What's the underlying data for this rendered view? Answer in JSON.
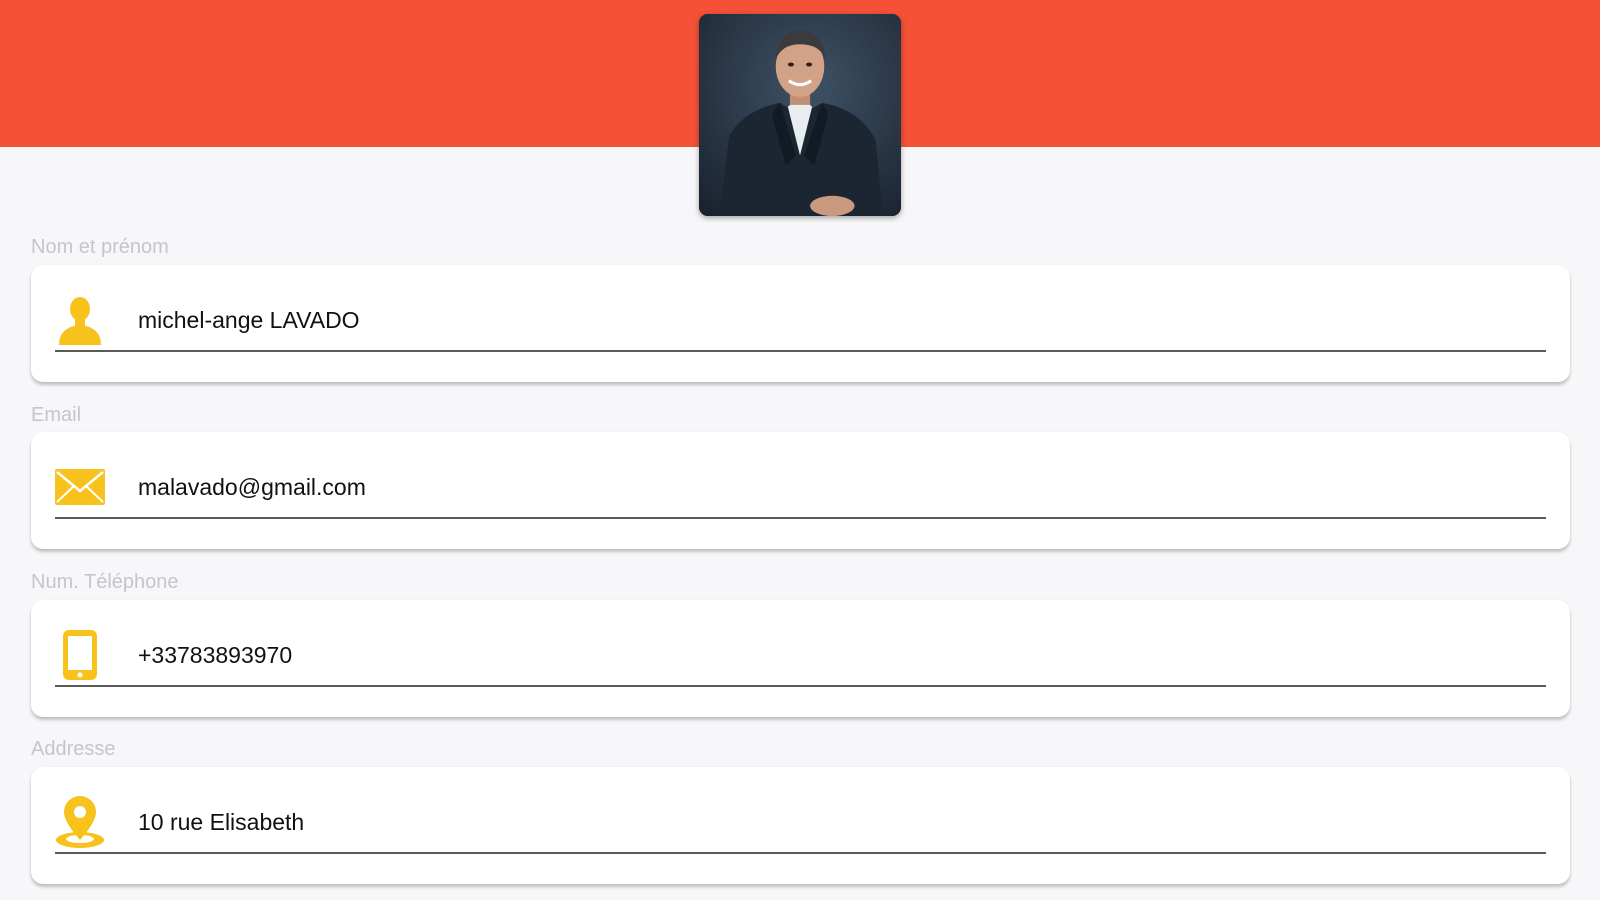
{
  "colors": {
    "header": "#f55137",
    "background": "#f7f7f9",
    "icon_accent": "#f7c21b",
    "label": "#c6c6c9",
    "value": "#111111"
  },
  "profile": {
    "avatar": "profile-photo"
  },
  "fields": {
    "name": {
      "label": "Nom et prénom",
      "value": "michel-ange LAVADO",
      "icon": "user-icon"
    },
    "email": {
      "label": "Email",
      "value": "malavado@gmail.com",
      "icon": "envelope-icon"
    },
    "phone": {
      "label": "Num. Téléphone",
      "value": "+33783893970",
      "icon": "smartphone-icon"
    },
    "address": {
      "label": "Addresse",
      "value": "10 rue Elisabeth",
      "icon": "map-pin-icon"
    }
  }
}
